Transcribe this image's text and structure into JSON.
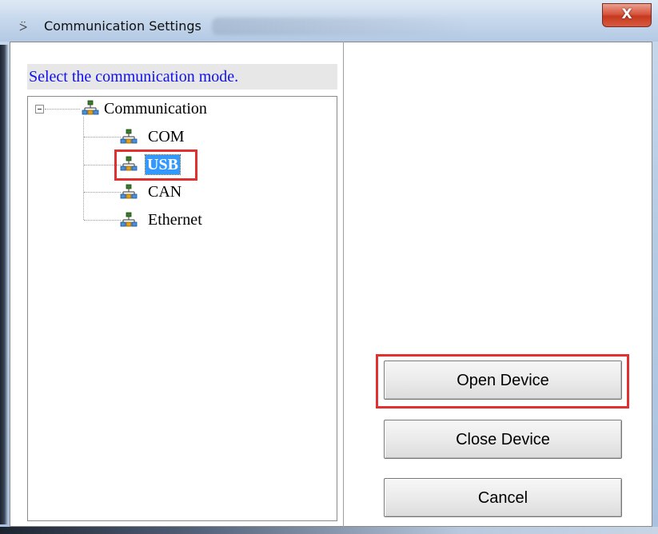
{
  "window": {
    "title": "Communication Settings",
    "app_icon": "usb-plug-icon",
    "close_label": "X"
  },
  "tree_panel": {
    "prompt": "Select the communication mode.",
    "root": {
      "label": "Communication",
      "expander": "⊟",
      "icon": "network-icon"
    },
    "items": [
      {
        "label": "COM",
        "icon": "network-icon",
        "selected": false
      },
      {
        "label": "USB",
        "icon": "network-icon",
        "selected": true
      },
      {
        "label": "CAN",
        "icon": "network-icon",
        "selected": false
      },
      {
        "label": "Ethernet",
        "icon": "network-icon",
        "selected": false
      }
    ]
  },
  "buttons": {
    "open_device": "Open Device",
    "close_device": "Close Device",
    "cancel": "Cancel"
  },
  "colors": {
    "selection": "#3399ff",
    "highlight_box": "#e03030",
    "prompt_text": "#1010ee"
  }
}
